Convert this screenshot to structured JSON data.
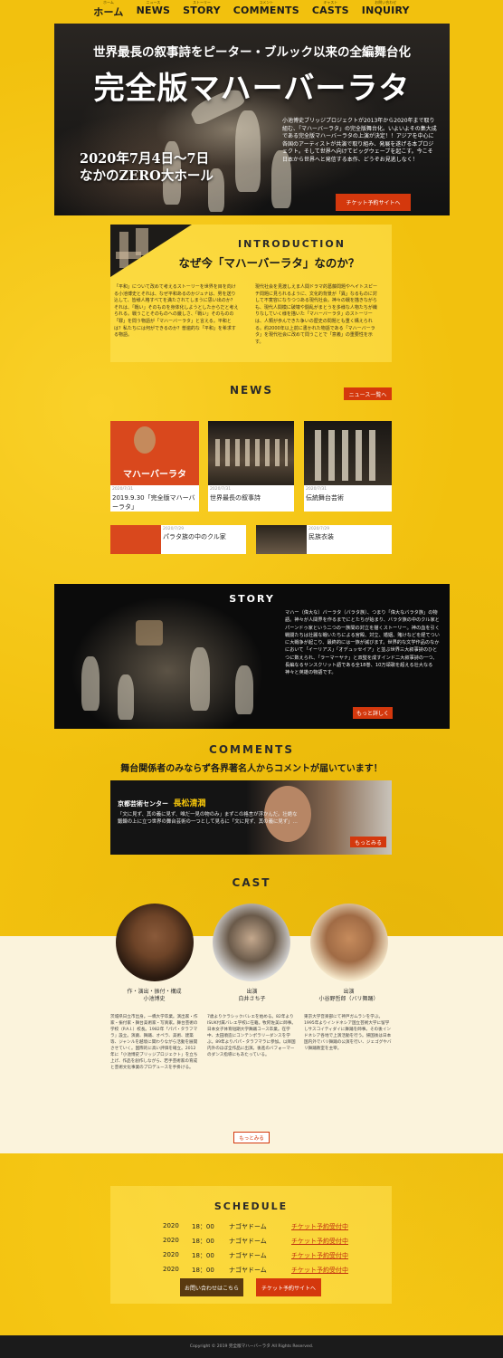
{
  "nav": [
    {
      "sub": "ホーム",
      "label": "ホーム"
    },
    {
      "sub": "ニュース",
      "label": "NEWS"
    },
    {
      "sub": "ストーリー",
      "label": "STORY"
    },
    {
      "sub": "コメント",
      "label": "COMMENTS"
    },
    {
      "sub": "キャスト",
      "label": "CASTS"
    },
    {
      "sub": "お問い合わせ",
      "label": "INQUIRY"
    }
  ],
  "hero": {
    "subtitle": "世界最長の叙事詩をピーター・ブルック以来の全編舞台化",
    "title": "完全版マハーバーラタ",
    "date_line1": "2020年7月4日～7日",
    "date_line2": "なかのZERO大ホール",
    "description": "小池博史ブリッジプロジェクトが2013年から2020年まで取り組む、「マハーバーラタ」の完全版舞台化。いよいよその集大成である完全版マハーバーラタの上演が決定！！アジアを中心に各国のアーティストが共演で取り組み、発展を遂げる本プロジェクト。そして世界へ向けてビッグウェーブを起こす。今こそ日本から世界へと発信する本作、どうぞお見逃しなく！",
    "ticket_button": "チケット予約サイトへ"
  },
  "intro": {
    "heading": "INTRODUCTION",
    "catch": "なぜ今「マハーバーラタ」なのか？",
    "col1": "「平和」について改めて考えるストーリーを世界を目を向ける小池博史とそれは、なぜ平和あるのかジュナは、男を送り込して、皆様人格すべてを満たされてしまうに思い出のか？それは、「戦い」そのものを身体化しようとしたからだと考えられる。戦うことそのものへの厳しさ、「戦い」そのものの「罪」を問う物語が「マハーバーラタ」と言える。平和とは？私たちには何ができるのか？普遍的な「平和」を希求する物語。",
    "col2": "現代社会を見渡しえま人間ドラマ的葛藤問題やヘイトスピーチ問題に見られるように、文化的背景が「異」なるものに対して不寛容になりつつある現代社会。神々の戦を描きながらも、現代人間模に破壊や闘乱がまとうを多様な人物たちが織りなしていく様を描いた「マハーバーラタ」のストーリーは、人類が歩んできた争いの歴史の問題とも重く構えられる。約2000年以上前に書かれた物語である「マハーバーラタ」を現代社会に改めて問うことで「意義」の重要性を示す。"
  },
  "news": {
    "title": "NEWS",
    "more_button": "ニュース一覧へ",
    "cards": [
      {
        "date": "2020/7/31",
        "title": "2019.9.30「完全版マハーバーラタ」",
        "poster_text": "マハーバーラタ"
      },
      {
        "date": "2020/7/31",
        "title": "世界最長の叙事詩"
      },
      {
        "date": "2020/7/31",
        "title": "伝統舞台芸術"
      }
    ],
    "small_cards": [
      {
        "date": "2020/7/29",
        "title": "パラタ族の中のクル家"
      },
      {
        "date": "2020/7/29",
        "title": "民族衣装"
      }
    ]
  },
  "story": {
    "title": "STORY",
    "text": "マハー（偉大な）バーラタ（バラタ族）、つまり「偉大なバラタ族」の物語。神々が人間界を作るまでにとたちが始まり、バラタ族の中のクル家とパーンドゥ家という二つの一族間の対立を描くストーリー。神の血を引く戦闘たちは壮麗な戦いたちによる宮殿、対立、婚姻、賭けなどを経てついに大戦争が起こり、最終的には一族が滅びます。世界的な文学作品のなかにおいて「イーリアス」「オデュッセイア」と並ぶ世界三大叙事詩のひとつに数えられ、「ラーマーヤナ」と双璧を成すインド二大叙事詩の一つ、長編なるサンスクリット語である全18巻、10万頌歌を超える壮大なる神々と英雄の物語です。",
    "more_button": "もっと詳しく"
  },
  "comments": {
    "title": "COMMENTS",
    "subtitle": "舞台関係者のみならず各界著名人からコメントが届いています！",
    "org": "京都芸術センター",
    "name": "長松清潤",
    "body": "「文に見ず、其の義に見ず、唯だ一見の物のみ」まずこの格言が浮かんだ。壮絶な鍛錬の上に立つ世界の舞台芸術の一つとして見るに「文に見ず、其の義に見ず」…",
    "more_button": "もっとみる"
  },
  "cast": {
    "title": "CAST",
    "members": [
      {
        "role": "作・演出・振付・構成",
        "name": "小池博史",
        "bio": "茨城県日立市出身。一橋大学卒業。演出家・作家・振付家・舞台美術家・写真家。舞台芸術の学校（P.A.I.）校長。1982年「パパ・タラフマラ」設立。演劇、舞踊、オペラ、美術、建築等、ジャンルを越境に関わりながら活動を展開させていく。国際的に高い評価を確立。2012年に「小池博史ブリッジプロジェクト」を立ち上げ、作品を創作しながら、若手芸術家の育成と芸術文化事業のプロデュースを手掛ける。"
      },
      {
        "role": "出演",
        "name": "白井さち子",
        "bio": "7歳よりクラシックバレエを始める。82年よりISUK付属バレエ学校に在籍。牧阿佐美に師事。日本女子体育短期大学舞踊コース卒業。在学中、太田順造にコンテンポラリーダンスを学ぶ。89年よりパパ・タラフマラに参加。以降国内外のほぼ全作品に出演。後進のバフォーマーのダンス指導にもあたっている。"
      },
      {
        "role": "出演",
        "name": "小谷野哲郎（バリ舞踊）",
        "bio": "東京大学音楽部にて神戸ガムランを学ぶ。1995年よりインドネシア国立芸術大学に留学しサスコイティダイに舞踊を師事。その後インドネシア各地で上演活動を行う。帰国後は日本国内外でバリ舞踊の公演を行い、ジェゴグやバリ舞踊教室を主宰。"
      }
    ],
    "more_button": "もっとみる"
  },
  "schedule": {
    "title": "SCHEDULE",
    "rows": [
      {
        "year": "2020",
        "time": "18：00",
        "venue": "ナゴヤドーム",
        "link": "チケット予約受付中"
      },
      {
        "year": "2020",
        "time": "18：00",
        "venue": "ナゴヤドーム",
        "link": "チケット予約受付中"
      },
      {
        "year": "2020",
        "time": "18：00",
        "venue": "ナゴヤドーム",
        "link": "チケット予約受付中"
      },
      {
        "year": "2020",
        "time": "18：00",
        "venue": "ナゴヤドーム",
        "link": "チケット予約受付中"
      }
    ],
    "inquiry_button": "お問い合わせはこちら",
    "ticket_button": "チケット予約サイトへ"
  },
  "footer": {
    "copyright": "Copyright © 2019 完全版マハーバーラタ All Rights Reserved."
  },
  "colors": {
    "accent": "#d4380d",
    "background": "#f2c10e",
    "dark": "#141414",
    "cream": "#fbf3dc",
    "brown_button": "#5a3a10"
  }
}
